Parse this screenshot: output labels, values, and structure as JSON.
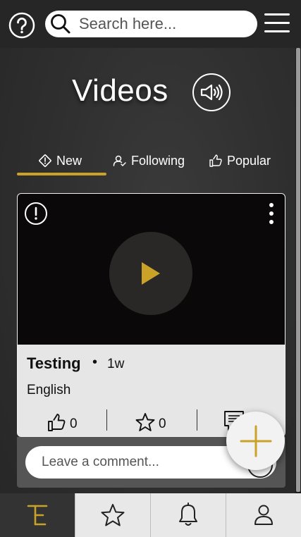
{
  "header": {
    "search_placeholder": "Search here..."
  },
  "page": {
    "title": "Videos"
  },
  "tabs": [
    {
      "label": "New",
      "icon": "diamond-alert-icon",
      "active": true
    },
    {
      "label": "Following",
      "icon": "user-check-icon",
      "active": false
    },
    {
      "label": "Popular",
      "icon": "thumbs-up-icon",
      "active": false
    }
  ],
  "video_card": {
    "title": "Testing",
    "separator": "•",
    "age": "1w",
    "language": "English",
    "likes": "0",
    "favorites": "0"
  },
  "comment": {
    "placeholder": "Leave a comment..."
  },
  "bottom_nav": [
    {
      "name": "home-logo",
      "active": true
    },
    {
      "name": "favorites",
      "active": false
    },
    {
      "name": "notifications",
      "active": false
    },
    {
      "name": "profile",
      "active": false
    }
  ],
  "colors": {
    "accent": "#c9a227",
    "header_bg": "#262626",
    "card_bg": "#e6e6e6",
    "video_bg": "#0a0808"
  }
}
